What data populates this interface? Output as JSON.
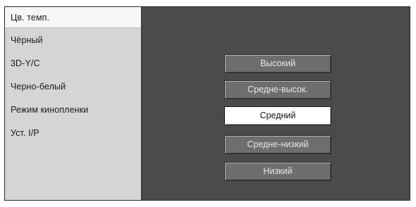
{
  "menu": {
    "items": [
      {
        "label": "Цв. темп.",
        "selected": true
      },
      {
        "label": "Чёрный",
        "selected": false
      },
      {
        "label": "3D-Y/C",
        "selected": false
      },
      {
        "label": "Черно-белый",
        "selected": false
      },
      {
        "label": "Режим кинопленки",
        "selected": false
      },
      {
        "label": "Уст. I/P",
        "selected": false
      }
    ]
  },
  "options": {
    "items": [
      {
        "label": "Высокий",
        "selected": false
      },
      {
        "label": "Средне-высок.",
        "selected": false
      },
      {
        "label": "Средний",
        "selected": true
      },
      {
        "label": "Средне-низкий",
        "selected": false
      },
      {
        "label": "Низкий",
        "selected": false
      }
    ]
  },
  "colors": {
    "panel_background": "#4b4b4b",
    "sidebar_background": "#d5d5d5",
    "selected_background": "#ffffff",
    "option_background": "#6e6e6e"
  }
}
